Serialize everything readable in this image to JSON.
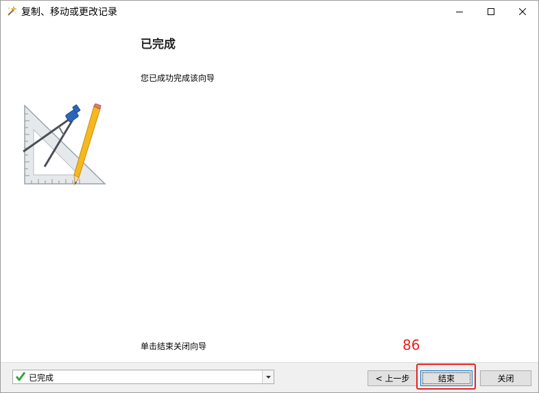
{
  "window": {
    "title": "复制、移动或更改记录",
    "title_icon": "magic-wand-icon"
  },
  "titlebar_buttons": {
    "minimize_icon": "minimize-icon",
    "maximize_icon": "maximize-icon",
    "close_icon": "close-icon"
  },
  "wizard": {
    "graphic_icon": "drafting-tools-icon",
    "heading": "已完成",
    "message": "您已成功完成该向导",
    "hint": "单击结束关闭向导"
  },
  "annotation": {
    "label": "86",
    "color": "#e8201c"
  },
  "footer": {
    "status": {
      "icon": "green-check-icon",
      "value": "已完成"
    },
    "buttons": {
      "back": "< 上一步",
      "finish": "结束",
      "close": "关闭"
    }
  },
  "colors": {
    "accent": "#0078d7",
    "highlight": "#e8201c",
    "check": "#2ea63a"
  }
}
